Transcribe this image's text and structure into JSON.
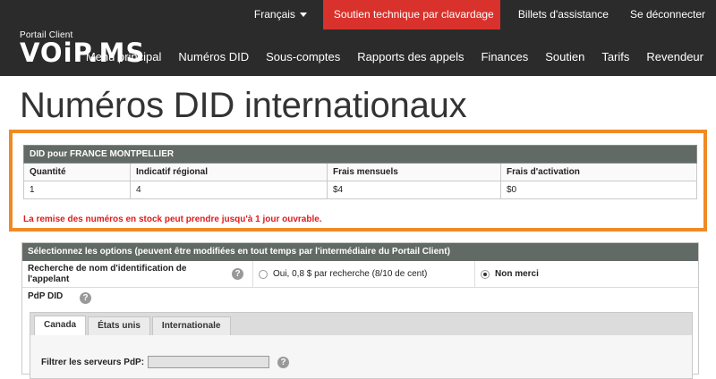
{
  "topnav": {
    "language": "Français",
    "support_chat": "Soutien technique par clavardage",
    "tickets": "Billets d'assistance",
    "logout": "Se déconnecter"
  },
  "logo": {
    "subtitle": "Portail Client",
    "brand": "VOiP.MS"
  },
  "mainnav": [
    "Menu principal",
    "Numéros DID",
    "Sous-comptes",
    "Rapports des appels",
    "Finances",
    "Soutien",
    "Tarifs",
    "Revendeur"
  ],
  "page_title": "Numéros DID internationaux",
  "did_table": {
    "title": "DID pour FRANCE MONTPELLIER",
    "columns": [
      "Quantité",
      "Indicatif régional",
      "Frais mensuels",
      "Frais d'activation"
    ],
    "row": [
      "1",
      "4",
      "$4",
      "$0"
    ]
  },
  "notice": "La remise des numéros en stock peut prendre jusqu'à 1 jour ouvrable.",
  "options": {
    "header": "Sélectionnez les options (peuvent être modifiées en tout temps par l'intermédiaire du Portail Client)",
    "cnam_label": "Recherche de nom d'identification de l'appelant",
    "cnam_yes": "Oui, 0,8 $ par recherche (8/10 de cent)",
    "cnam_no": "Non merci",
    "pop_label": "PdP DID",
    "tabs": [
      "Canada",
      "États unis",
      "Internationale"
    ],
    "filter_label": "Filtrer les serveurs PdP:"
  },
  "colors": {
    "topbar": "#2b2b2b",
    "accent_red": "#d9312b",
    "highlight_orange": "#f08a24",
    "table_header": "#626a66"
  }
}
